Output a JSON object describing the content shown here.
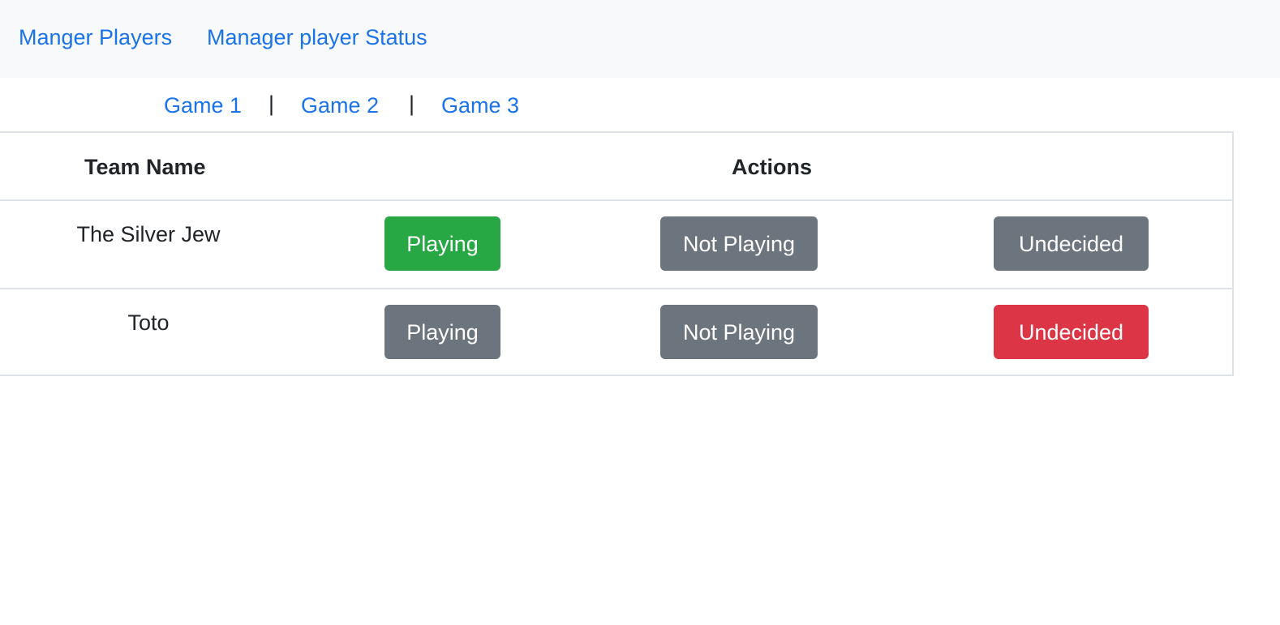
{
  "navbar": {
    "links": [
      {
        "label": "Manger Players"
      },
      {
        "label": "Manager player Status"
      }
    ]
  },
  "games": {
    "links": [
      {
        "label": "Game 1"
      },
      {
        "label": "Game 2"
      },
      {
        "label": "Game 3"
      }
    ],
    "separator": "|"
  },
  "table": {
    "headers": {
      "team_name": "Team Name",
      "actions": "Actions"
    },
    "rows": [
      {
        "team": "The Silver Jew",
        "playing": "Playing",
        "not_playing": "Not Playing",
        "undecided": "Undecided",
        "selected": "playing"
      },
      {
        "team": "Toto",
        "playing": "Playing",
        "not_playing": "Not Playing",
        "undecided": "Undecided",
        "selected": "undecided"
      }
    ]
  },
  "colors": {
    "link": "#1a73e8",
    "playing_active": "#28a745",
    "undecided_active": "#dc3545",
    "inactive": "#6c757d",
    "navbar_bg": "#f8f9fa"
  }
}
